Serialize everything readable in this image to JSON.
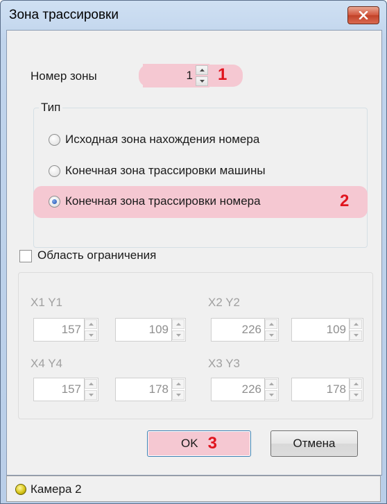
{
  "window": {
    "title": "Зона трассировки"
  },
  "zone": {
    "label": "Номер зоны",
    "value": "1",
    "marker": "1"
  },
  "type_group": {
    "title": "Тип",
    "options": [
      {
        "label": "Исходная зона нахождения номера",
        "selected": false
      },
      {
        "label": "Конечная зона трассировки машины",
        "selected": false
      },
      {
        "label": "Конечная зона трассировки номера",
        "selected": true
      }
    ],
    "marker": "2"
  },
  "restriction": {
    "label": "Область ограничения",
    "checked": false,
    "points": [
      {
        "title": "X1 Y1",
        "x": "157",
        "y": "109"
      },
      {
        "title": "X2 Y2",
        "x": "226",
        "y": "109"
      },
      {
        "title": "X4 Y4",
        "x": "157",
        "y": "178"
      },
      {
        "title": "X3 Y3",
        "x": "226",
        "y": "178"
      }
    ]
  },
  "buttons": {
    "ok": "OK",
    "ok_marker": "3",
    "cancel": "Отмена"
  },
  "status": {
    "camera": "Камера 2"
  },
  "colors": {
    "highlight": "#f5c8d2",
    "marker": "#e0141e"
  }
}
